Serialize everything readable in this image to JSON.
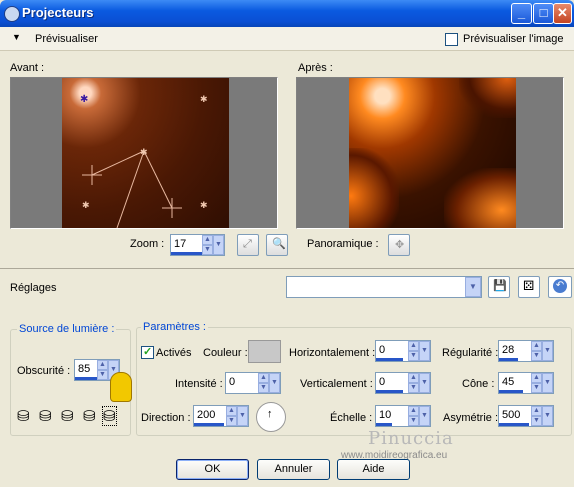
{
  "window": {
    "title": "Projecteurs",
    "min": "_",
    "max": "□",
    "close": "✕"
  },
  "preview": {
    "toggle": "Prévisualiser",
    "checkbox_label": "Prévisualiser l'image"
  },
  "before_label": "Avant :",
  "after_label": "Après :",
  "zoom": {
    "label": "Zoom :",
    "value": "17"
  },
  "pan_label": "Panoramique :",
  "presets": {
    "label": "Réglages",
    "value": ""
  },
  "light_source": {
    "title": "Source de lumière :",
    "darkness_label": "Obscurité :",
    "darkness_value": "85"
  },
  "params": {
    "title": "Paramètres :",
    "active_label": "Activés",
    "color_label": "Couleur :",
    "intensity_label": "Intensité :",
    "intensity_value": "0",
    "direction_label": "Direction :",
    "direction_value": "200",
    "horizontal_label": "Horizontalement :",
    "horizontal_value": "0",
    "vertical_label": "Verticalement :",
    "vertical_value": "0",
    "scale_label": "Échelle :",
    "scale_value": "10",
    "regularity_label": "Régularité :",
    "regularity_value": "28",
    "cone_label": "Cône :",
    "cone_value": "45",
    "asymmetry_label": "Asymétrie :",
    "asymmetry_value": "500"
  },
  "watermark": {
    "line1": "Pinuccia",
    "line2": "www.moidireografica.eu"
  },
  "buttons": {
    "ok": "OK",
    "cancel": "Annuler",
    "help": "Aide"
  },
  "colors": {
    "accent": "#0046d5",
    "preview_bg": "#7a7a7a"
  }
}
